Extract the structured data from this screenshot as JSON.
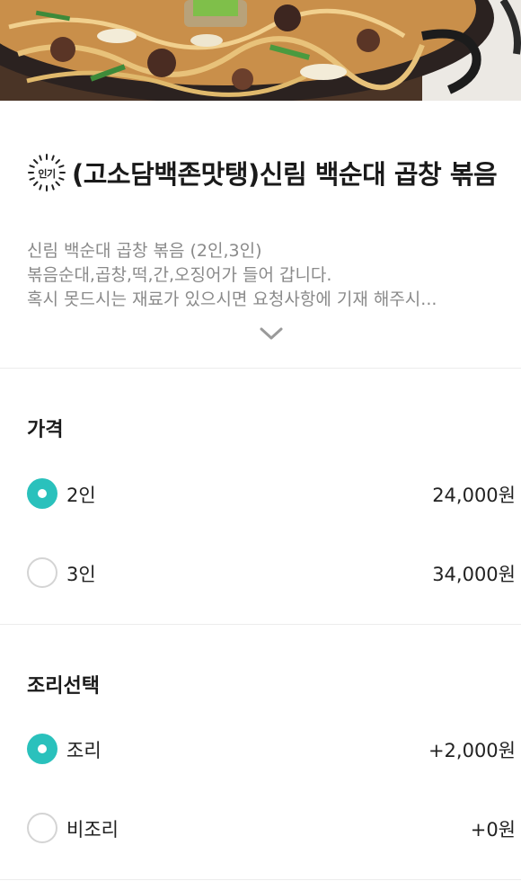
{
  "menu": {
    "badge_text": "인기",
    "title": "(고소담백존맛탱)신림 백순대 곱창 볶음",
    "description_lines": [
      "신림 백순대 곱창 볶음 (2인,3인)",
      "볶음순대,곱창,떡,간,오징어가 들어 갑니다.",
      "혹시 못드시는 재료가 있으시면 요청사항에 기재 해주시..."
    ]
  },
  "price_section": {
    "title": "가격",
    "options": [
      {
        "label": "2인",
        "price": "24,000원",
        "selected": true
      },
      {
        "label": "3인",
        "price": "34,000원",
        "selected": false
      }
    ]
  },
  "cooking_section": {
    "title": "조리선택",
    "options": [
      {
        "label": "조리",
        "price": "+2,000원",
        "selected": true
      },
      {
        "label": "비조리",
        "price": "+0원",
        "selected": false
      }
    ]
  },
  "colors": {
    "accent": "#2ac1bc",
    "text": "#222222",
    "muted": "#8a8a8a",
    "divider": "#ececec"
  }
}
